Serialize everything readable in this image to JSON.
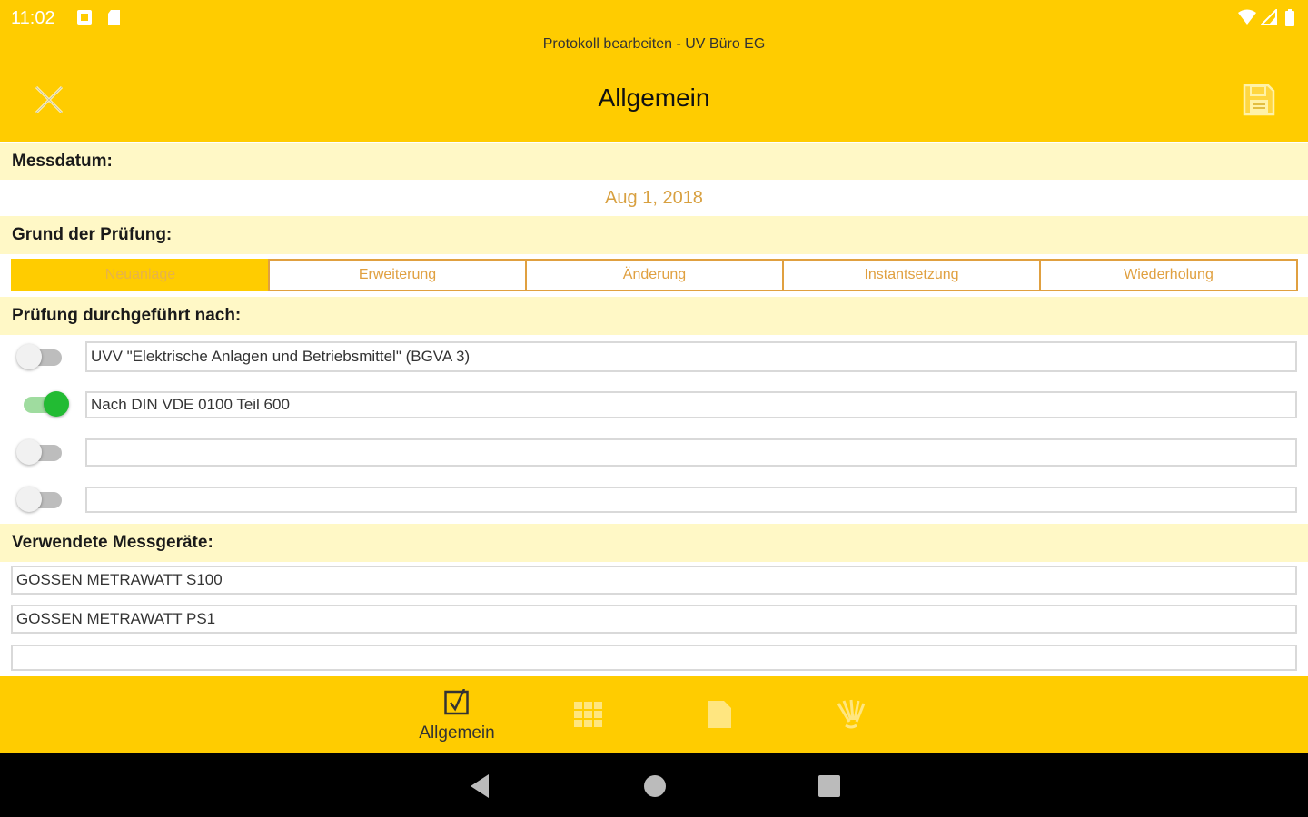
{
  "status_bar": {
    "time": "11:02"
  },
  "header": {
    "subtitle": "Protokoll bearbeiten - UV Büro EG",
    "title": "Allgemein",
    "close_icon": "close-icon",
    "save_icon": "save-icon"
  },
  "messdatum": {
    "label": "Messdatum:",
    "value": "Aug 1, 2018"
  },
  "grund": {
    "label": "Grund der Prüfung:",
    "options": [
      "Neuanlage",
      "Erweiterung",
      "Änderung",
      "Instantsetzung",
      "Wiederholung"
    ],
    "selected": "Neuanlage"
  },
  "pruefung": {
    "label": "Prüfung durchgeführt nach:",
    "items": [
      {
        "on": false,
        "value": "UVV \"Elektrische Anlagen und Betriebsmittel\" (BGVA 3)"
      },
      {
        "on": true,
        "value": "Nach DIN VDE 0100 Teil 600"
      },
      {
        "on": false,
        "value": ""
      },
      {
        "on": false,
        "value": ""
      }
    ]
  },
  "messgeraete": {
    "label": "Verwendete Messgeräte:",
    "items": [
      "GOSSEN METRAWATT S100",
      "GOSSEN METRAWATT PS1",
      ""
    ]
  },
  "bottom_nav": {
    "active_label": "Allgemein",
    "items": [
      "checkbox-icon",
      "grid-icon",
      "document-icon",
      "signature-icon"
    ]
  },
  "colors": {
    "accent": "#ffcc00",
    "section_bg": "#fff8c6",
    "segment_border": "#e0a040",
    "toggle_on": "#22bb33"
  }
}
